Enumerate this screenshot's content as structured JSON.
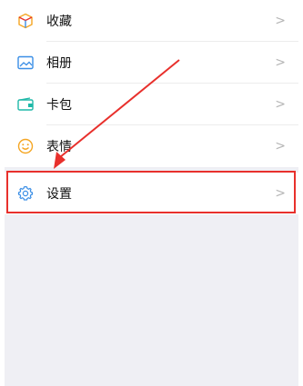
{
  "menu": {
    "items": [
      {
        "label": "收藏",
        "chevron": ">",
        "icon": "favorites-cube-icon"
      },
      {
        "label": "相册",
        "chevron": ">",
        "icon": "album-image-icon"
      },
      {
        "label": "卡包",
        "chevron": ">",
        "icon": "card-wallet-icon"
      },
      {
        "label": "表情",
        "chevron": ">",
        "icon": "emoji-smile-icon"
      }
    ],
    "settings": {
      "label": "设置",
      "chevron": ">",
      "icon": "gear-icon"
    }
  },
  "colors": {
    "background": "#efeff4",
    "row_background": "#ffffff",
    "annotation_red": "#e8302c",
    "chevron_gray": "#b5b5b5",
    "icon_blue": "#3a8ee6",
    "icon_orange": "#f5a623",
    "icon_teal": "#1fb8a8"
  }
}
